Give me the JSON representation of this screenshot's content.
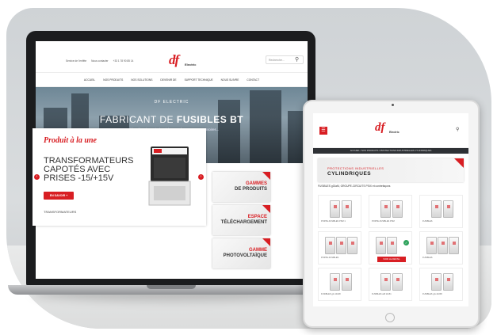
{
  "laptop_site": {
    "top_links": [
      "Service de l'enfête",
      "Nous contacter",
      "+33 1 78 90 85 14"
    ],
    "logo": "df",
    "logo_sub": "Electric",
    "search_placeholder": "Recherche...",
    "search_icon": "magnifier",
    "menu": [
      "ACCUEIL",
      "NOS PRODUITS",
      "NOS SOLUTIONS",
      "DEVENIR DE",
      "SUPPORT TECHNIQUE",
      "NOUS SUIVRE",
      "CONTACT"
    ],
    "hero_brand": "DF ELECTRIC",
    "hero_title_pre": "FABRICANT DE ",
    "hero_title_bold": "FUSIBLES BT",
    "hero_sub": "Fusibles électriques, industriels, Transformateurs, Accessoires...",
    "promo": {
      "kicker": "Produit à la une",
      "title": "TRANSFORMATEURS CAPOTÉS AVEC PRISES -15/+15V",
      "button": "EN SAVOIR +",
      "footer": "TRANSFORMATEURS"
    },
    "side_cards": [
      {
        "line1": "GAMMES",
        "line2": "DE PRODUITS"
      },
      {
        "line1": "ESPACE",
        "line2": "TÉLÉCHARGEMENT"
      },
      {
        "line1": "GAMME",
        "line2": "PHOTOVOLTAÏQUE"
      }
    ]
  },
  "tablet_site": {
    "logo": "df",
    "logo_sub": "Electric",
    "breadcrumb": "ACCUEIL  /  NOS PRODUITS  /  PROTECTIONS INDUSTRIELLES CYLINDRIQUES",
    "banner_line1": "PROTECTIONS INDUSTRIELLES",
    "banner_line2": "CYLINDRIQUES",
    "intro": "FUSIBLES gG/aM, GROUPE-CIRCUITS PSIX et contrefaçons",
    "detail_button": "VOIR LE DETAIL",
    "captions": [
      "PORTE-FUSIBLES PSM 1",
      "PORTE-FUSIBLES PSM",
      "FUSIBLES",
      "PORTE-FUSIBLES",
      "",
      "FUSIBLES",
      "FUSIBLES gG 10x38",
      "FUSIBLES aM 14x51",
      "FUSIBLES gG 22x58"
    ]
  },
  "colors": {
    "brand_red": "#d81e23",
    "dark": "#2e3135"
  }
}
